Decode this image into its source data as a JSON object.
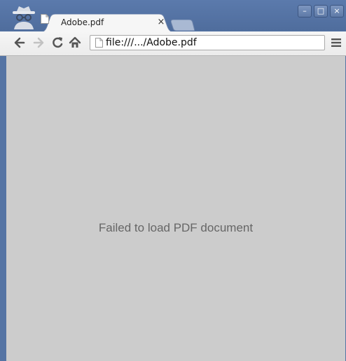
{
  "tab": {
    "title": "Adobe.pdf",
    "close_glyph": "×",
    "favicon": "page-icon"
  },
  "window_controls": {
    "minimize": "–",
    "maximize": "□",
    "close": "×"
  },
  "toolbar": {
    "back_icon": "back-arrow-icon",
    "forward_icon": "forward-arrow-icon",
    "reload_icon": "reload-icon",
    "home_icon": "home-icon",
    "menu_icon": "hamburger-menu-icon"
  },
  "omnibox": {
    "url": "file:///.../Adobe.pdf",
    "icon": "page-icon"
  },
  "content": {
    "message": "Failed to load PDF document",
    "background": "#cccccc"
  },
  "colors": {
    "frame": "#5574a4",
    "toolbar": "#f2f2f2",
    "message": "#666666"
  }
}
